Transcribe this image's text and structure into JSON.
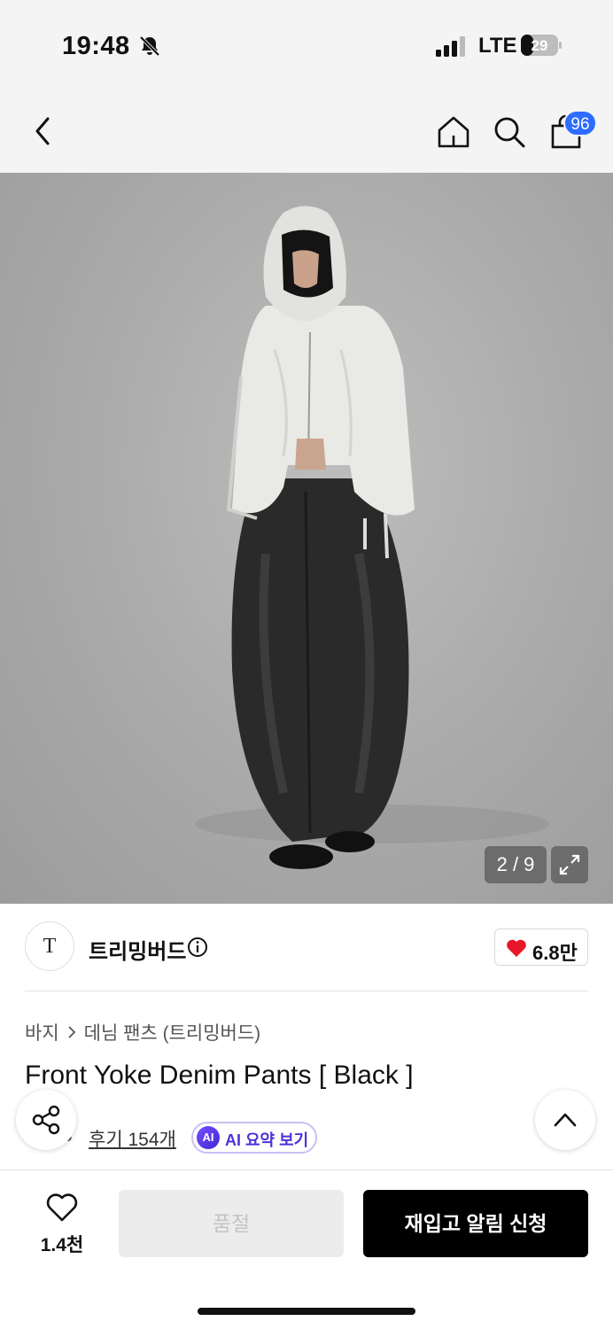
{
  "status_bar": {
    "time": "19:48",
    "network": "LTE",
    "battery": "29"
  },
  "nav": {
    "cart_count": "96"
  },
  "gallery": {
    "counter": "2 / 9"
  },
  "brand": {
    "logo_letter": "T",
    "name": "트리밍버드",
    "likes": "6.8만"
  },
  "breadcrumb": {
    "category": "바지",
    "subcategory": "데님 팬츠 (트리밍버드)"
  },
  "product": {
    "title": "Front Yoke Denim Pants [ Black ]"
  },
  "rating": {
    "score": ".8",
    "reviews": "후기 154개",
    "ai_badge": "AI",
    "ai_label": "AI 요약 보기"
  },
  "bottom_bar": {
    "wishlist_count": "1.4천",
    "soldout_label": "품절",
    "restock_label": "재입고 알림 신청"
  },
  "colors": {
    "accent": "#2e6bff",
    "heart": "#e8162b",
    "ai_purple": "#4b33d8"
  }
}
